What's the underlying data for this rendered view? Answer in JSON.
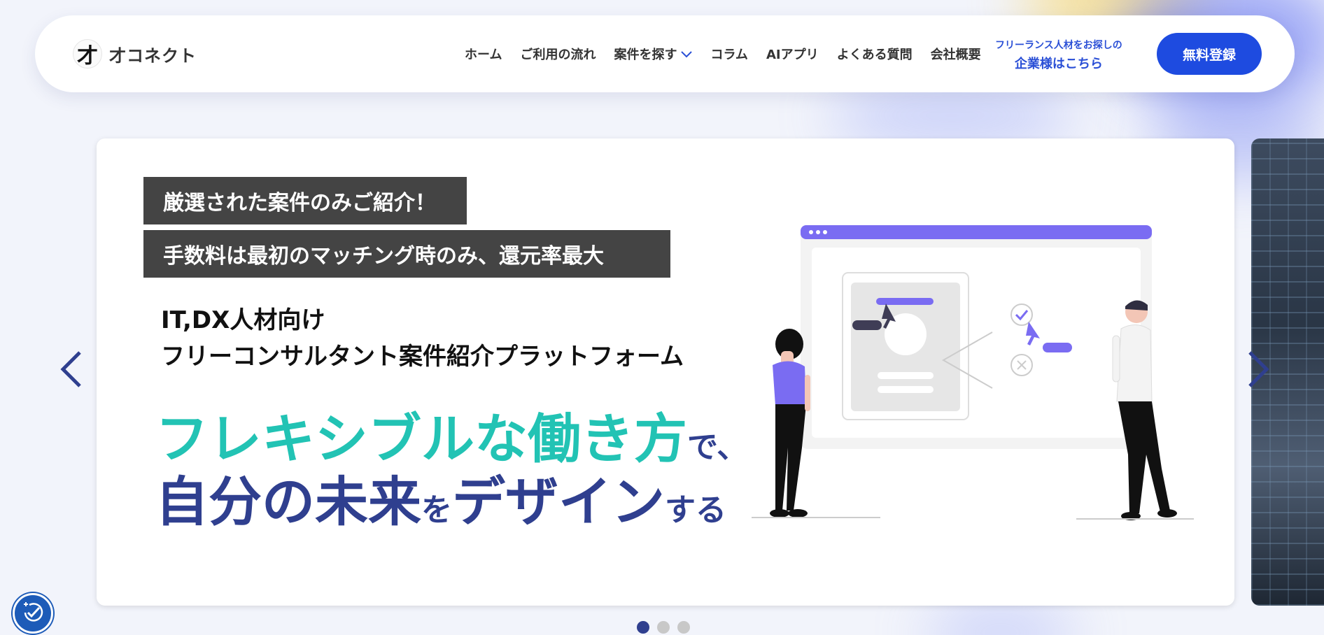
{
  "header": {
    "logo_mark": "才",
    "logo_text": "才コネクト",
    "nav": [
      {
        "label": "ホーム"
      },
      {
        "label": "ご利用の流れ"
      },
      {
        "label": "案件を探す",
        "has_dropdown": true
      },
      {
        "label": "コラム"
      },
      {
        "label": "AIアプリ"
      },
      {
        "label": "よくある質問"
      },
      {
        "label": "会社概要"
      }
    ],
    "biz_link_line1": "フリーランス人材をお探しの",
    "biz_link_line2": "企業様はこちら",
    "register_label": "無料登録",
    "accent_color": "#1e4be0"
  },
  "slide": {
    "tag1": "厳選された案件のみご紹介！",
    "tag2": "手数料は最初のマッチング時のみ、還元率最大",
    "sub1": "IT,DX人材向け",
    "sub2": "フリーコンサルタント案件紹介プラットフォーム",
    "headline1_big": "フレキシブルな働き方",
    "headline1_small": "で、",
    "headline2_a": "自分の未来",
    "headline2_b": "を",
    "headline2_c": "デザイン",
    "headline2_d": "する",
    "teal_color": "#22c3b4",
    "navy_color": "#2f3f8f"
  },
  "slider": {
    "slide_count": 3,
    "active_index": 0,
    "prev_icon": "chevron-left-icon",
    "next_icon": "chevron-right-icon"
  },
  "accessibility_icon": "accessibility-check-icon"
}
